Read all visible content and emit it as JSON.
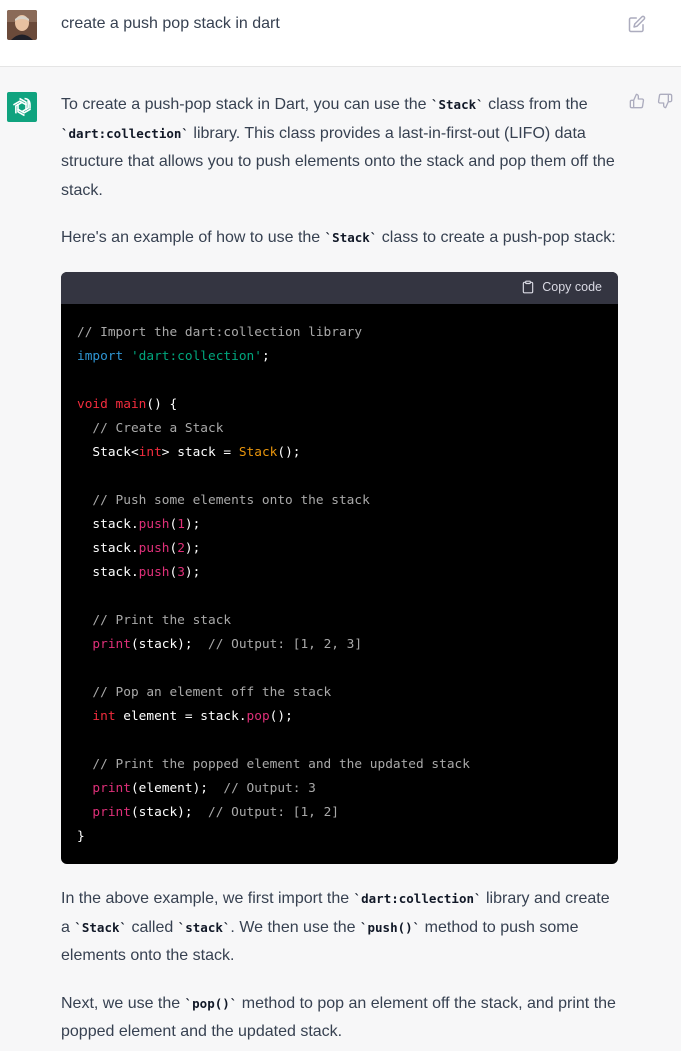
{
  "user": {
    "prompt": "create a push pop stack in dart"
  },
  "icons": {
    "edit": "edit-icon",
    "thumbs_up": "thumbs-up-icon",
    "thumbs_down": "thumbs-down-icon",
    "copy": "clipboard-icon",
    "assistant_logo": "openai-logo-icon"
  },
  "colors": {
    "assistant_logo_bg": "#10a37f",
    "code_bg": "#000000",
    "code_header_bg": "#343541"
  },
  "assistant": {
    "para1": {
      "t1": "To create a push-pop stack in Dart, you can use the ",
      "c1": "`Stack`",
      "t2": " class from the ",
      "c2": "`dart:collection`",
      "t3": " library. This class provides a last-in-first-out (LIFO) data structure that allows you to push elements onto the stack and pop them off the stack."
    },
    "para2": {
      "t1": "Here's an example of how to use the ",
      "c1": "`Stack`",
      "t2": " class to create a push-pop stack:"
    },
    "code": {
      "copy_label": "Copy code",
      "lines": {
        "l1": "// Import the dart:collection library",
        "l2_kw": "import",
        "l2_str": "'dart:collection'",
        "l2_end": ";",
        "l4_kw": "void",
        "l4_fn": "main",
        "l4_end": "() {",
        "l5": "// Create a Stack",
        "l6_a": "Stack<",
        "l6_type": "int",
        "l6_b": "> stack = ",
        "l6_ctor": "Stack",
        "l6_end": "();",
        "l8": "// Push some elements onto the stack",
        "l9_a": "stack.",
        "l9_fn": "push",
        "l9_open": "(",
        "l9_num": "1",
        "l9_end": ");",
        "l10_a": "stack.",
        "l10_fn": "push",
        "l10_open": "(",
        "l10_num": "2",
        "l10_end": ");",
        "l11_a": "stack.",
        "l11_fn": "push",
        "l11_open": "(",
        "l11_num": "3",
        "l11_end": ");",
        "l13": "// Print the stack",
        "l14_fn": "print",
        "l14_a": "(stack);  ",
        "l14_c": "// Output: [1, 2, 3]",
        "l16": "// Pop an element off the stack",
        "l17_type": "int",
        "l17_a": " element = stack.",
        "l17_fn": "pop",
        "l17_end": "();",
        "l19": "// Print the popped element and the updated stack",
        "l20_fn": "print",
        "l20_a": "(element);  ",
        "l20_c": "// Output: 3",
        "l21_fn": "print",
        "l21_a": "(stack);  ",
        "l21_c": "// Output: [1, 2]",
        "l22": "}"
      }
    },
    "para3": {
      "t1": "In the above example, we first import the ",
      "c1": "`dart:collection`",
      "t2": " library and create a ",
      "c2": "`Stack`",
      "t3": " called ",
      "c3": "`stack`",
      "t4": ". We then use the ",
      "c4": "`push()`",
      "t5": " method to push some elements onto the stack."
    },
    "para4": {
      "t1": "Next, we use the ",
      "c1": "`pop()`",
      "t2": " method to pop an element off the stack, and print the popped element and the updated stack."
    }
  }
}
